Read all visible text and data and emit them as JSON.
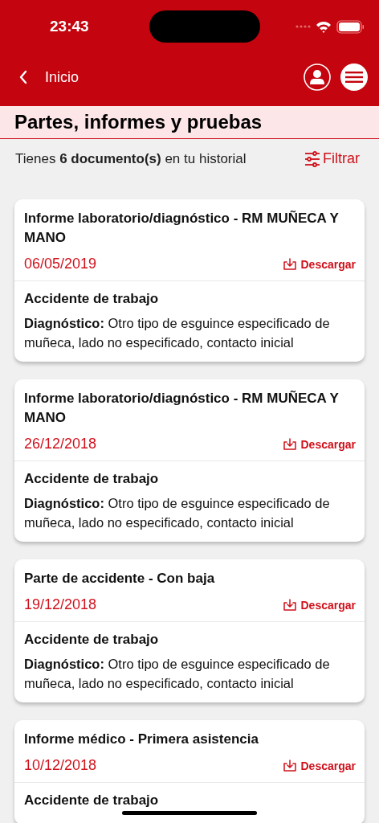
{
  "status_bar": {
    "time": "23:43"
  },
  "nav_bar": {
    "back_label": "Inicio"
  },
  "page_title": "Partes, informes y pruebas",
  "summary": {
    "text": "Tienes **6 documento(s)** en tu historial",
    "filter_label": "Filtrar"
  },
  "documents": [
    {
      "title": "Informe laboratorio/diagnóstico - RM MUÑECA Y MANO",
      "date": "06/05/2019",
      "download_label": "Descargar",
      "category": "Accidente de trabajo",
      "diagnosis": "**Diagnóstico:** Otro tipo de esguince especificado de muñeca, lado no especificado, contacto inicial"
    },
    {
      "title": "Informe laboratorio/diagnóstico - RM MUÑECA Y MANO",
      "date": "26/12/2018",
      "download_label": "Descargar",
      "category": "Accidente de trabajo",
      "diagnosis": "**Diagnóstico:** Otro tipo de esguince especificado de muñeca, lado no especificado, contacto inicial"
    },
    {
      "title": "Parte de accidente - Con baja",
      "date": "19/12/2018",
      "download_label": "Descargar",
      "category": "Accidente de trabajo",
      "diagnosis": "**Diagnóstico:** Otro tipo de esguince especificado de muñeca, lado no especificado, contacto inicial"
    },
    {
      "title": "Informe médico - Primera asistencia",
      "date": "10/12/2018",
      "download_label": "Descargar",
      "category": "Accidente de trabajo"
    }
  ]
}
